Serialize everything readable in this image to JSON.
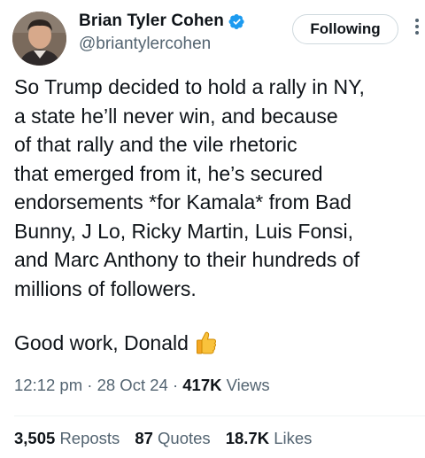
{
  "author": {
    "display_name": "Brian Tyler Cohen",
    "handle": "@briantylercohen",
    "verified_icon": "verified-badge-icon",
    "verified_color": "#1d9bf0"
  },
  "follow_button": {
    "label": "Following"
  },
  "more_icon": "vertical-ellipsis-icon",
  "tweet": {
    "lines": [
      "So Trump decided to hold a rally in NY,",
      "a state he’ll never win, and because",
      "of that rally and the vile rhetoric",
      "that emerged from it, he’s secured",
      "endorsements *for Kamala* from Bad",
      "Bunny, J Lo, Ricky Martin, Luis Fonsi,",
      "and Marc Anthony to their hundreds of",
      "millions of followers."
    ],
    "closing": "Good work, Donald",
    "closing_emoji": "thumbs-up-icon"
  },
  "meta": {
    "time": "12:12 pm",
    "separator": "·",
    "date": "28 Oct 24",
    "views_count": "417K",
    "views_label": "Views"
  },
  "stats": {
    "reposts": {
      "count": "3,505",
      "label": "Reposts"
    },
    "quotes": {
      "count": "87",
      "label": "Quotes"
    },
    "likes": {
      "count": "18.7K",
      "label": "Likes"
    }
  },
  "colors": {
    "text": "#0f1419",
    "secondary": "#536471",
    "border": "#cfd9de",
    "accent": "#1d9bf0"
  }
}
